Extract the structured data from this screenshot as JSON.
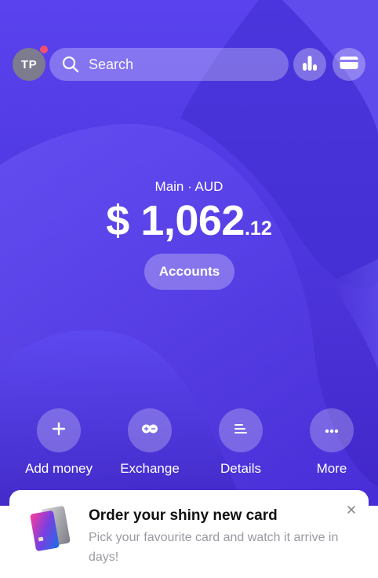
{
  "header": {
    "avatar_initials": "TP",
    "search_placeholder": "Search",
    "icons": [
      "analytics-icon",
      "card-icon"
    ]
  },
  "balance": {
    "account_label": "Main · AUD",
    "currency_symbol": "$",
    "whole": "1,062",
    "cents": ".12",
    "accounts_button": "Accounts"
  },
  "actions": [
    {
      "label": "Add money",
      "icon": "plus-icon"
    },
    {
      "label": "Exchange",
      "icon": "exchange-icon"
    },
    {
      "label": "Details",
      "icon": "details-icon"
    },
    {
      "label": "More",
      "icon": "more-icon"
    }
  ],
  "promo": {
    "title": "Order your shiny new card",
    "description": "Pick your favourite card and watch it arrive in days!"
  },
  "colors": {
    "accent": "#4e37df",
    "notification_dot": "#f0506e"
  }
}
